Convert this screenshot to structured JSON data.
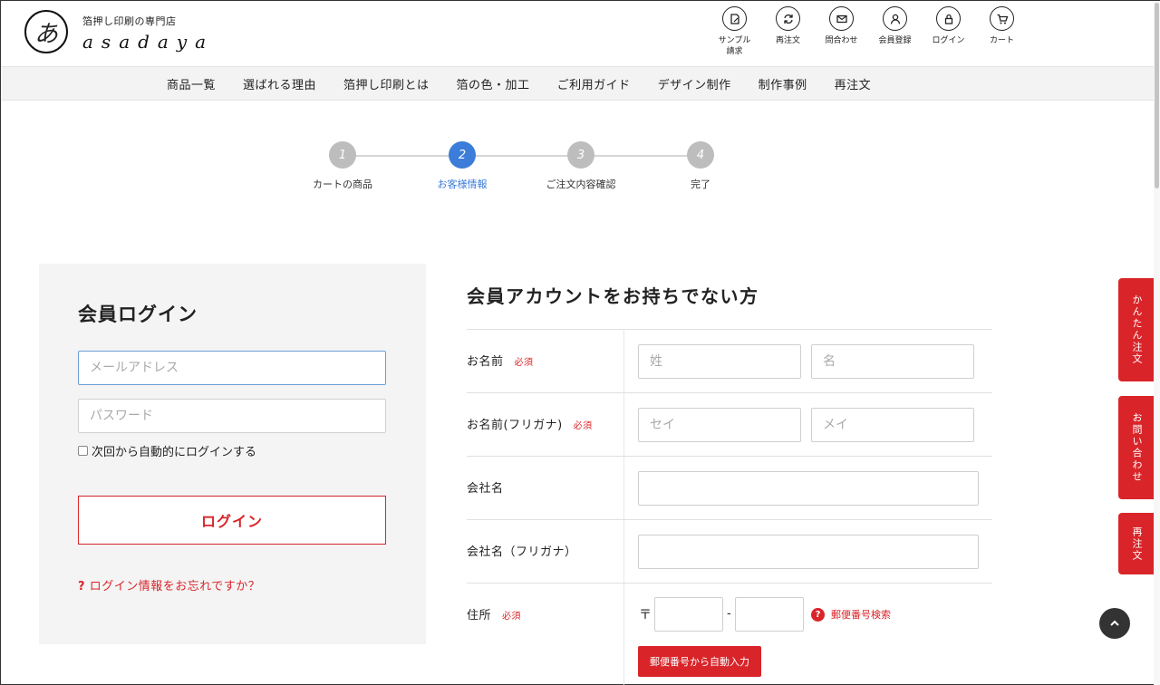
{
  "header": {
    "logo_glyph": "あ",
    "tagline": "箔押し印刷の専門店",
    "brand": "asadaya",
    "util_nav": [
      {
        "label": "サンプル\n請求",
        "icon": "sample-icon"
      },
      {
        "label": "再注文",
        "icon": "reorder-icon"
      },
      {
        "label": "問合わせ",
        "icon": "mail-icon"
      },
      {
        "label": "会員登録",
        "icon": "user-icon"
      },
      {
        "label": "ログイン",
        "icon": "lock-icon"
      },
      {
        "label": "カート",
        "icon": "cart-icon"
      }
    ]
  },
  "gnav": [
    "商品一覧",
    "選ばれる理由",
    "箔押し印刷とは",
    "箔の色・加工",
    "ご利用ガイド",
    "デザイン制作",
    "制作事例",
    "再注文"
  ],
  "stepper": {
    "steps": [
      {
        "num": "1",
        "label": "カートの商品"
      },
      {
        "num": "2",
        "label": "お客様情報"
      },
      {
        "num": "3",
        "label": "ご注文内容確認"
      },
      {
        "num": "4",
        "label": "完了"
      }
    ],
    "active_index": 1
  },
  "login": {
    "title": "会員ログイン",
    "email_placeholder": "メールアドレス",
    "password_placeholder": "パスワード",
    "remember_label": "次回から自動的にログインする",
    "button_label": "ログイン",
    "forgot_label": "ログイン情報をお忘れですか？"
  },
  "register": {
    "title": "会員アカウントをお持ちでない方",
    "required_label": "必須",
    "name": {
      "label": "お名前",
      "last_placeholder": "姓",
      "first_placeholder": "名"
    },
    "kana": {
      "label": "お名前(フリガナ)",
      "last_placeholder": "セイ",
      "first_placeholder": "メイ"
    },
    "company": {
      "label": "会社名"
    },
    "company_kana": {
      "label": "会社名（フリガナ）"
    },
    "address": {
      "label": "住所",
      "zip_mark": "〒",
      "dash": "-",
      "zip_search_label": "郵便番号検索",
      "auto_fill_label": "郵便番号から自動入力"
    }
  },
  "side_tabs": [
    "かんたん注文",
    "お問い合わせ",
    "再注文"
  ],
  "colors": {
    "accent_red": "#d9252a",
    "active_blue": "#3b7dd8"
  }
}
